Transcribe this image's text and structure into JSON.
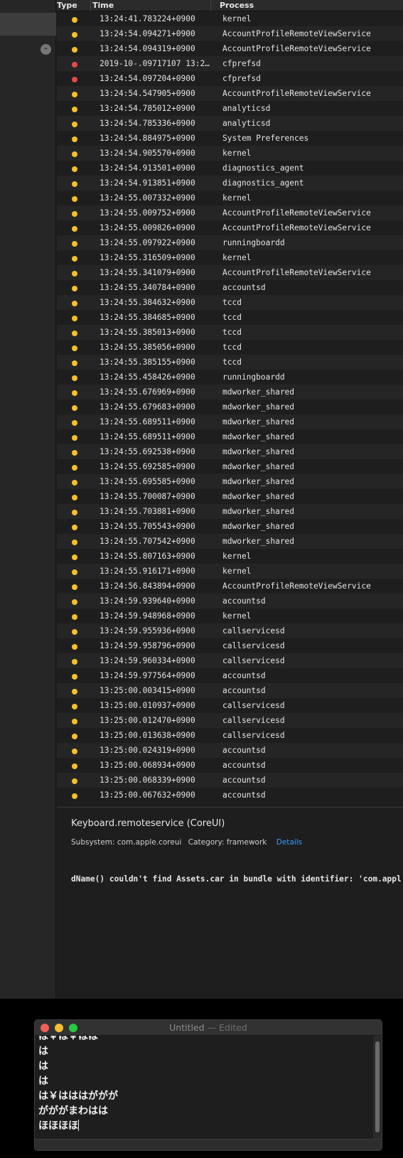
{
  "colors": {
    "warning_dot": "#f6c026",
    "error_dot": "#e5484d",
    "link": "#3b9cff"
  },
  "sidebar": {
    "activity_icon": "activity-icon"
  },
  "table": {
    "headers": {
      "type": "Type",
      "time": "Time",
      "process": "Process"
    },
    "rows": [
      {
        "level": "warning",
        "time": "13:24:41.783224+0900",
        "process": "kernel"
      },
      {
        "level": "warning",
        "time": "13:24:54.094271+0900",
        "process": "AccountProfileRemoteViewService"
      },
      {
        "level": "warning",
        "time": "13:24:54.094319+0900",
        "process": "AccountProfileRemoteViewService"
      },
      {
        "level": "error",
        "time": "2019-10-.09717107 13:2…",
        "process": "cfprefsd"
      },
      {
        "level": "error",
        "time": "13:24:54.097204+0900",
        "process": "cfprefsd"
      },
      {
        "level": "warning",
        "time": "13:24:54.547905+0900",
        "process": "AccountProfileRemoteViewService"
      },
      {
        "level": "warning",
        "time": "13:24:54.785012+0900",
        "process": "analyticsd"
      },
      {
        "level": "warning",
        "time": "13:24:54.785336+0900",
        "process": "analyticsd"
      },
      {
        "level": "warning",
        "time": "13:24:54.884975+0900",
        "process": "System Preferences"
      },
      {
        "level": "warning",
        "time": "13:24:54.905570+0900",
        "process": "kernel"
      },
      {
        "level": "warning",
        "time": "13:24:54.913501+0900",
        "process": "diagnostics_agent"
      },
      {
        "level": "warning",
        "time": "13:24:54.913851+0900",
        "process": "diagnostics_agent"
      },
      {
        "level": "warning",
        "time": "13:24:55.007332+0900",
        "process": "kernel"
      },
      {
        "level": "warning",
        "time": "13:24:55.009752+0900",
        "process": "AccountProfileRemoteViewService"
      },
      {
        "level": "warning",
        "time": "13:24:55.009826+0900",
        "process": "AccountProfileRemoteViewService"
      },
      {
        "level": "warning",
        "time": "13:24:55.097922+0900",
        "process": "runningboardd"
      },
      {
        "level": "warning",
        "time": "13:24:55.316509+0900",
        "process": "kernel"
      },
      {
        "level": "warning",
        "time": "13:24:55.341079+0900",
        "process": "AccountProfileRemoteViewService"
      },
      {
        "level": "warning",
        "time": "13:24:55.340784+0900",
        "process": "accountsd"
      },
      {
        "level": "warning",
        "time": "13:24:55.384632+0900",
        "process": "tccd"
      },
      {
        "level": "warning",
        "time": "13:24:55.384685+0900",
        "process": "tccd"
      },
      {
        "level": "warning",
        "time": "13:24:55.385013+0900",
        "process": "tccd"
      },
      {
        "level": "warning",
        "time": "13:24:55.385056+0900",
        "process": "tccd"
      },
      {
        "level": "warning",
        "time": "13:24:55.385155+0900",
        "process": "tccd"
      },
      {
        "level": "warning",
        "time": "13:24:55.458426+0900",
        "process": "runningboardd"
      },
      {
        "level": "warning",
        "time": "13:24:55.676969+0900",
        "process": "mdworker_shared"
      },
      {
        "level": "warning",
        "time": "13:24:55.679683+0900",
        "process": "mdworker_shared"
      },
      {
        "level": "warning",
        "time": "13:24:55.689511+0900",
        "process": "mdworker_shared"
      },
      {
        "level": "warning",
        "time": "13:24:55.689511+0900",
        "process": "mdworker_shared"
      },
      {
        "level": "warning",
        "time": "13:24:55.692538+0900",
        "process": "mdworker_shared"
      },
      {
        "level": "warning",
        "time": "13:24:55.692585+0900",
        "process": "mdworker_shared"
      },
      {
        "level": "warning",
        "time": "13:24:55.695585+0900",
        "process": "mdworker_shared"
      },
      {
        "level": "warning",
        "time": "13:24:55.700087+0900",
        "process": "mdworker_shared"
      },
      {
        "level": "warning",
        "time": "13:24:55.703881+0900",
        "process": "mdworker_shared"
      },
      {
        "level": "warning",
        "time": "13:24:55.705543+0900",
        "process": "mdworker_shared"
      },
      {
        "level": "warning",
        "time": "13:24:55.707542+0900",
        "process": "mdworker_shared"
      },
      {
        "level": "warning",
        "time": "13:24:55.807163+0900",
        "process": "kernel"
      },
      {
        "level": "warning",
        "time": "13:24:55.916171+0900",
        "process": "kernel"
      },
      {
        "level": "warning",
        "time": "13:24:56.843894+0900",
        "process": "AccountProfileRemoteViewService"
      },
      {
        "level": "warning",
        "time": "13:24:59.939640+0900",
        "process": "accountsd"
      },
      {
        "level": "warning",
        "time": "13:24:59.948968+0900",
        "process": "kernel"
      },
      {
        "level": "warning",
        "time": "13:24:59.955936+0900",
        "process": "callservicesd"
      },
      {
        "level": "warning",
        "time": "13:24:59.958796+0900",
        "process": "callservicesd"
      },
      {
        "level": "warning",
        "time": "13:24:59.960334+0900",
        "process": "callservicesd"
      },
      {
        "level": "warning",
        "time": "13:24:59.977564+0900",
        "process": "accountsd"
      },
      {
        "level": "warning",
        "time": "13:25:00.003415+0900",
        "process": "accountsd"
      },
      {
        "level": "warning",
        "time": "13:25:00.010937+0900",
        "process": "callservicesd"
      },
      {
        "level": "warning",
        "time": "13:25:00.012470+0900",
        "process": "callservicesd"
      },
      {
        "level": "warning",
        "time": "13:25:00.013638+0900",
        "process": "callservicesd"
      },
      {
        "level": "warning",
        "time": "13:25:00.024319+0900",
        "process": "accountsd"
      },
      {
        "level": "warning",
        "time": "13:25:00.068934+0900",
        "process": "accountsd"
      },
      {
        "level": "warning",
        "time": "13:25:00.068339+0900",
        "process": "accountsd"
      },
      {
        "level": "warning",
        "time": "13:25:00.067632+0900",
        "process": "accountsd"
      }
    ]
  },
  "detail": {
    "title": "Keyboard.remoteservice (CoreUI)",
    "subsystem_label": "Subsystem:",
    "subsystem": "com.apple.coreui",
    "category_label": "Category:",
    "category": "framework",
    "details_link": "Details",
    "message": "dName() couldn't find Assets.car in bundle with identifier: 'com.appl"
  },
  "editor": {
    "title": "Untitled",
    "edited": " — Edited",
    "lines": [
      "は￥は￥はは",
      "は",
      "は",
      "は",
      "は￥はははががが",
      "がががまわはは",
      "ほほほほ"
    ]
  }
}
